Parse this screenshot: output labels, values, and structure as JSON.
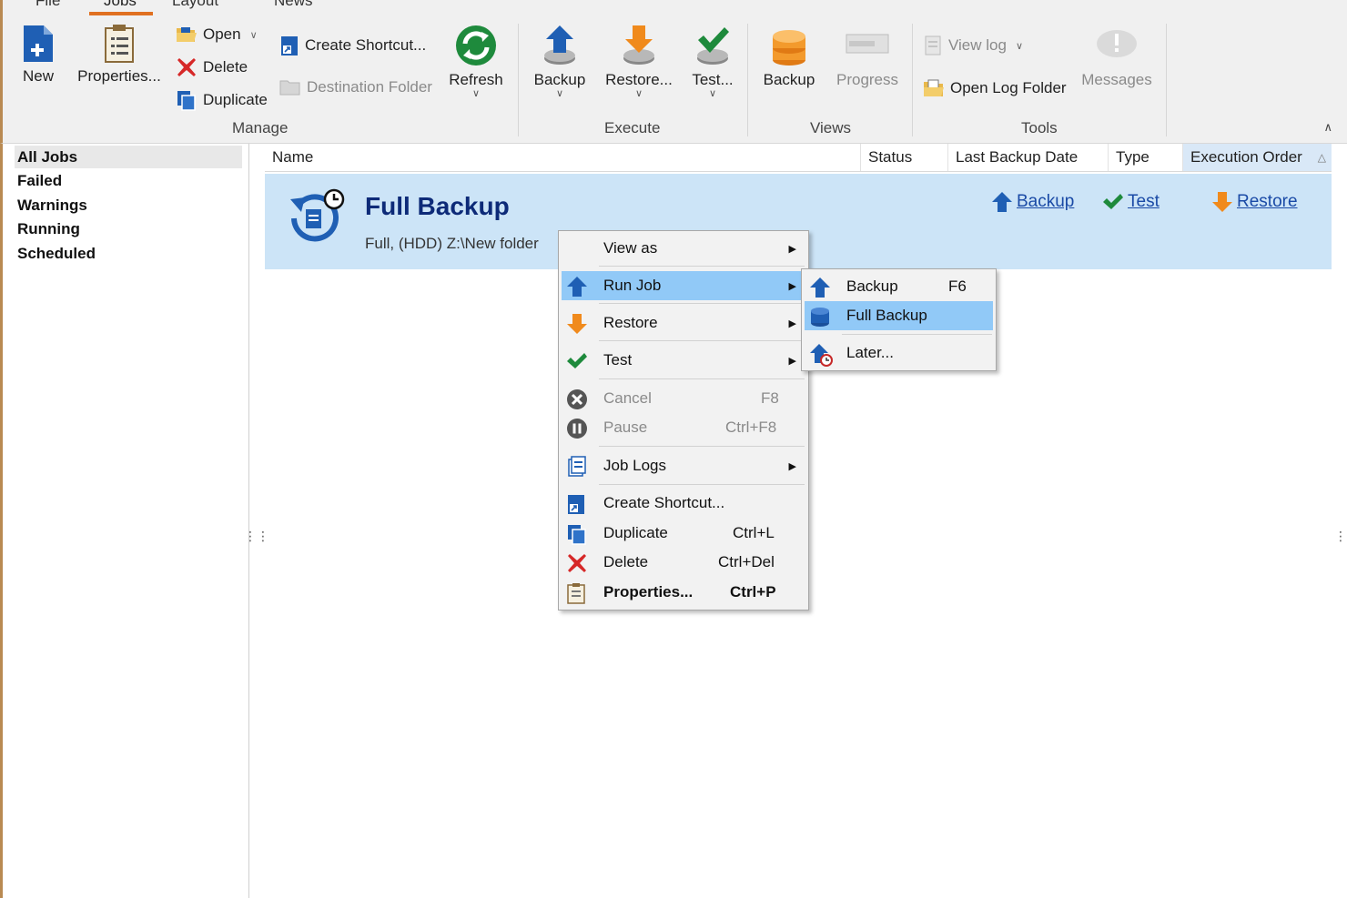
{
  "tabs": [
    "File",
    "Jobs",
    "Layout",
    "News"
  ],
  "ribbon": {
    "new": "New",
    "properties": "Properties...",
    "open": "Open",
    "delete": "Delete",
    "duplicate": "Duplicate",
    "create_shortcut": "Create Shortcut...",
    "destination_folder": "Destination Folder",
    "refresh": "Refresh",
    "exec_backup": "Backup",
    "exec_restore": "Restore...",
    "exec_test": "Test...",
    "view_backup": "Backup",
    "view_progress": "Progress",
    "view_log": "View log",
    "open_log_folder": "Open Log Folder",
    "messages": "Messages",
    "groups": {
      "manage": "Manage",
      "execute": "Execute",
      "views": "Views",
      "tools": "Tools"
    }
  },
  "filters": [
    "All Jobs",
    "Failed",
    "Warnings",
    "Running",
    "Scheduled"
  ],
  "columns": [
    "Name",
    "Status",
    "Last Backup Date",
    "Type",
    "Execution Order"
  ],
  "job": {
    "title": "Full Backup",
    "desc": "Full, (HDD) Z:\\New folder",
    "links": {
      "backup": "Backup",
      "test": "Test",
      "restore": "Restore"
    }
  },
  "context_menu": {
    "view_as": "View as",
    "run_job": "Run Job",
    "restore": "Restore",
    "test": "Test",
    "cancel": "Cancel",
    "cancel_sc": "F8",
    "pause": "Pause",
    "pause_sc": "Ctrl+F8",
    "job_logs": "Job Logs",
    "create_shortcut": "Create Shortcut...",
    "duplicate": "Duplicate",
    "duplicate_sc": "Ctrl+L",
    "delete": "Delete",
    "delete_sc": "Ctrl+Del",
    "properties": "Properties...",
    "properties_sc": "Ctrl+P"
  },
  "submenu": {
    "backup": "Backup",
    "backup_sc": "F6",
    "full_backup": "Full Backup",
    "later": "Later..."
  },
  "colors": {
    "accent": "#e07020",
    "selection": "#cce4f7",
    "menu_highlight": "#91c9f7",
    "title_blue": "#0d2a78",
    "link_blue": "#1a4aa6"
  }
}
